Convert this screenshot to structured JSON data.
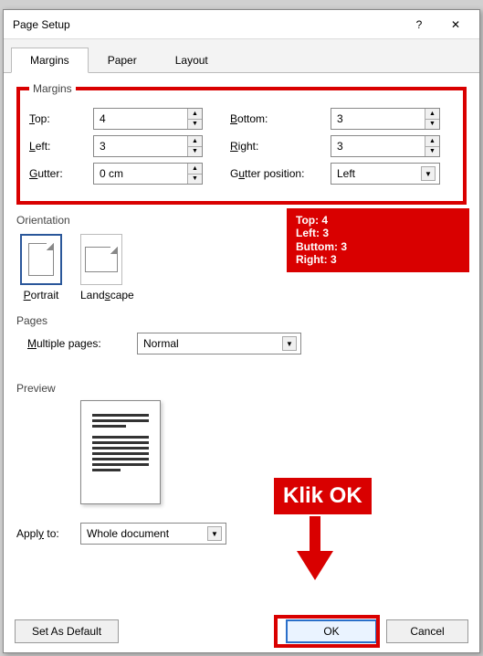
{
  "dialog": {
    "title": "Page Setup",
    "help_icon": "?",
    "close_icon": "✕"
  },
  "tabs": {
    "margins": "Margins",
    "paper": "Paper",
    "layout": "Layout",
    "active": "Margins"
  },
  "margins": {
    "legend": "Margins",
    "top_label": "Top:",
    "top_value": "4",
    "bottom_label": "Bottom:",
    "bottom_value": "3",
    "left_label": "Left:",
    "left_value": "3",
    "right_label": "Right:",
    "right_value": "3",
    "gutter_label": "Gutter:",
    "gutter_value": "0 cm",
    "gutter_pos_label": "Gutter position:",
    "gutter_pos_value": "Left"
  },
  "orientation": {
    "legend": "Orientation",
    "portrait": "Portrait",
    "landscape": "Landscape",
    "selected": "Portrait"
  },
  "pages": {
    "legend": "Pages",
    "multiple_label": "Multiple pages:",
    "multiple_value": "Normal"
  },
  "preview": {
    "legend": "Preview"
  },
  "apply": {
    "label": "Apply to:",
    "value": "Whole document"
  },
  "buttons": {
    "default": "Set As Default",
    "ok": "OK",
    "cancel": "Cancel"
  },
  "annotations": {
    "margins_box": "Top: 4\nLeft: 3\nButtom: 3\nRight: 3",
    "m1": "Top: 4",
    "m2": "Left: 3",
    "m3": "Buttom: 3",
    "m4": "Right: 3",
    "klik": "Klik OK"
  }
}
